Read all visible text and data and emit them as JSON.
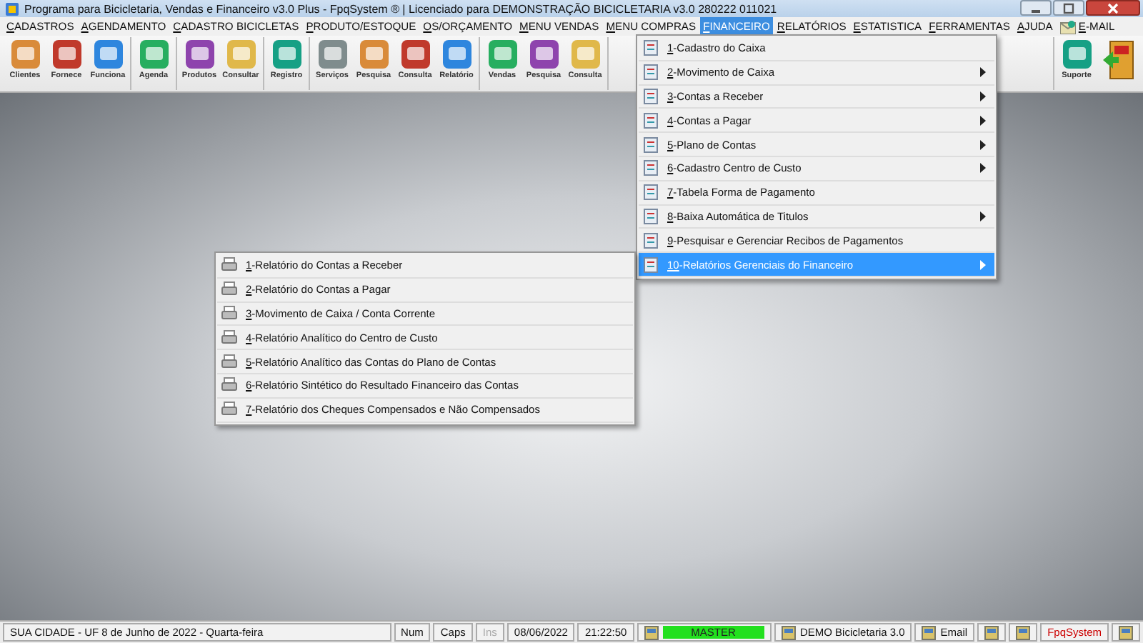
{
  "window": {
    "title": "Programa para Bicicletaria, Vendas e Financeiro v3.0 Plus - FpqSystem ® | Licenciado para  DEMONSTRAÇÃO BICICLETARIA v3.0 280222 011021"
  },
  "menubar": [
    {
      "label": "CADASTROS",
      "selected": false
    },
    {
      "label": "AGENDAMENTO",
      "selected": false
    },
    {
      "label": "CADASTRO BICICLETAS",
      "selected": false
    },
    {
      "label": "PRODUTO/ESTOQUE",
      "selected": false
    },
    {
      "label": "OS/ORÇAMENTO",
      "selected": false
    },
    {
      "label": "MENU VENDAS",
      "selected": false
    },
    {
      "label": "MENU COMPRAS",
      "selected": false
    },
    {
      "label": "FINANCEIRO",
      "selected": true
    },
    {
      "label": "RELATÓRIOS",
      "selected": false
    },
    {
      "label": "ESTATISTICA",
      "selected": false
    },
    {
      "label": "FERRAMENTAS",
      "selected": false
    },
    {
      "label": "AJUDA",
      "selected": false
    },
    {
      "label": "E-MAIL",
      "selected": false,
      "icon": true
    }
  ],
  "toolbar": {
    "groups": [
      [
        {
          "label": "Clientes"
        },
        {
          "label": "Fornece"
        },
        {
          "label": "Funciona"
        }
      ],
      [
        {
          "label": "Agenda"
        }
      ],
      [
        {
          "label": "Produtos"
        },
        {
          "label": "Consultar"
        }
      ],
      [
        {
          "label": "Registro"
        }
      ],
      [
        {
          "label": "Serviços"
        },
        {
          "label": "Pesquisa"
        },
        {
          "label": "Consulta"
        },
        {
          "label": "Relatório"
        }
      ],
      [
        {
          "label": "Vendas"
        },
        {
          "label": "Pesquisa"
        },
        {
          "label": "Consulta"
        }
      ]
    ],
    "right": [
      {
        "label": "Suporte"
      },
      {
        "exit": true
      }
    ]
  },
  "financeiro_menu": [
    {
      "key": "1",
      "text": "-Cadastro do Caixa",
      "submenu": false,
      "selected": false
    },
    {
      "key": "2",
      "text": "-Movimento de Caixa",
      "submenu": true,
      "selected": false
    },
    {
      "key": "3",
      "text": "-Contas a Receber",
      "submenu": true,
      "selected": false
    },
    {
      "key": "4",
      "text": "-Contas a Pagar",
      "submenu": true,
      "selected": false
    },
    {
      "key": "5",
      "text": "-Plano de Contas",
      "submenu": true,
      "selected": false
    },
    {
      "key": "6",
      "text": "-Cadastro Centro de Custo",
      "submenu": true,
      "selected": false
    },
    {
      "key": "7",
      "text": "-Tabela Forma de Pagamento",
      "submenu": false,
      "selected": false
    },
    {
      "key": "8",
      "text": "-Baixa Automática de Titulos",
      "submenu": true,
      "selected": false
    },
    {
      "key": "9",
      "text": "-Pesquisar e Gerenciar Recibos de Pagamentos",
      "submenu": false,
      "selected": false
    },
    {
      "key": "10",
      "text": "-Relatórios Gerenciais do Financeiro",
      "submenu": true,
      "selected": true
    }
  ],
  "relatorios_submenu": [
    {
      "key": "1",
      "text": "-Relatório do Contas a Receber"
    },
    {
      "key": "2",
      "text": "-Relatório do Contas a Pagar"
    },
    {
      "key": "3",
      "text": "-Movimento de Caixa / Conta Corrente"
    },
    {
      "key": "4",
      "text": "-Relatório Analítico do Centro de Custo"
    },
    {
      "key": "5",
      "text": "-Relatório Analítico das Contas do Plano de Contas"
    },
    {
      "key": "6",
      "text": "-Relatório Sintético do Resultado Financeiro das Contas"
    },
    {
      "key": "7",
      "text": "-Relatório dos Cheques Compensados e Não Compensados"
    }
  ],
  "status_bar": [
    {
      "kind": "text",
      "text": "SUA CIDADE - UF  8 de Junho de 2022 - Quarta-feira",
      "disabled": false
    },
    {
      "kind": "text",
      "text": "Num",
      "disabled": false
    },
    {
      "kind": "text",
      "text": "Caps",
      "disabled": false
    },
    {
      "kind": "text",
      "text": "Ins",
      "disabled": true
    },
    {
      "kind": "text",
      "text": "08/06/2022",
      "disabled": false
    },
    {
      "kind": "text",
      "text": "21:22:50",
      "disabled": false
    },
    {
      "kind": "highlight",
      "text": "MASTER"
    },
    {
      "kind": "icon_text",
      "text": "DEMO Bicicletaria 3.0"
    },
    {
      "kind": "icon_text",
      "text": "Email"
    },
    {
      "kind": "icon"
    },
    {
      "kind": "icon"
    },
    {
      "kind": "brand",
      "text": "FpqSystem"
    },
    {
      "kind": "icon"
    }
  ]
}
